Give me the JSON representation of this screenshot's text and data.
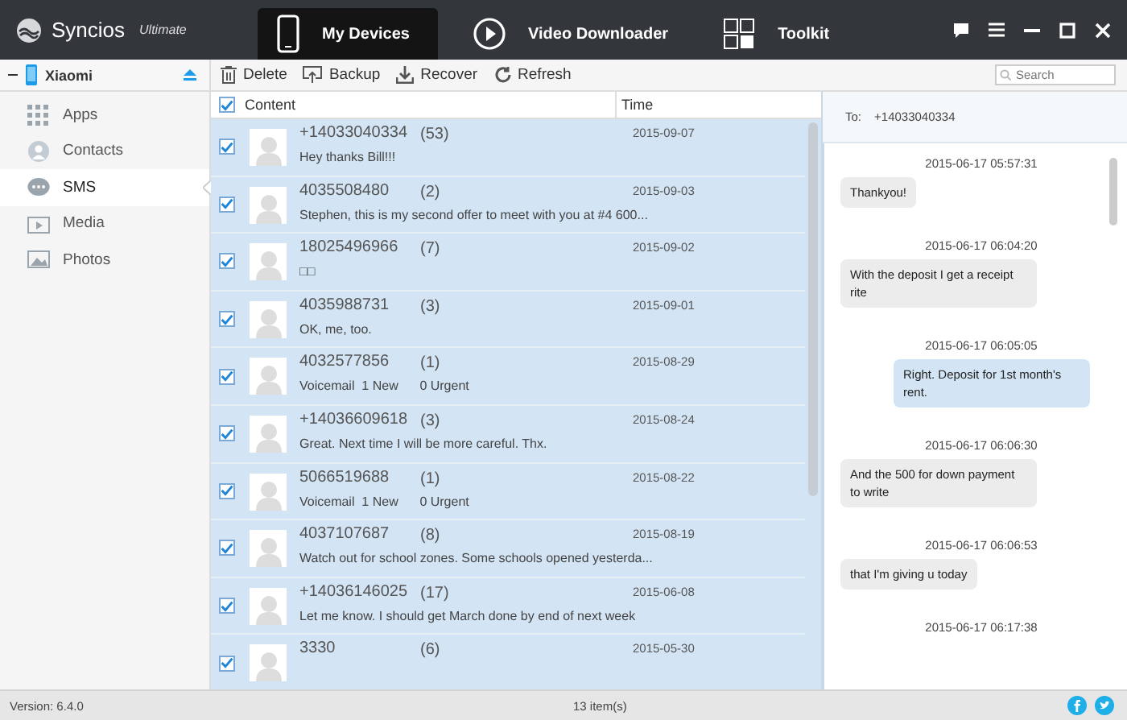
{
  "app": {
    "name": "Syncios",
    "edition": "Ultimate"
  },
  "tabs": [
    {
      "label": "My Devices",
      "selected": true
    },
    {
      "label": "Video Downloader",
      "selected": false
    },
    {
      "label": "Toolkit",
      "selected": false
    }
  ],
  "device": {
    "name": "Xiaomi"
  },
  "sidebar": {
    "items": [
      {
        "label": "Apps",
        "selected": false
      },
      {
        "label": "Contacts",
        "selected": false
      },
      {
        "label": "SMS",
        "selected": true
      },
      {
        "label": "Media",
        "selected": false
      },
      {
        "label": "Photos",
        "selected": false
      }
    ]
  },
  "toolbar": [
    {
      "label": "Delete"
    },
    {
      "label": "Backup"
    },
    {
      "label": "Recover"
    },
    {
      "label": "Refresh"
    }
  ],
  "search": {
    "placeholder": "Search"
  },
  "list": {
    "all_checked": true,
    "columns": [
      "Content",
      "Time"
    ],
    "rows": [
      {
        "number": "+14033040334",
        "count": "(53)",
        "preview": "Hey thanks Bill!!!",
        "time": "2015-09-07",
        "checked": true
      },
      {
        "number": "4035508480",
        "count": "(2)",
        "preview": "Stephen, this is my second offer to meet with you at #4 600...",
        "time": "2015-09-03",
        "checked": true
      },
      {
        "number": "18025496966",
        "count": "(7)",
        "preview": "□□",
        "time": "2015-09-02",
        "checked": true
      },
      {
        "number": "4035988731",
        "count": "(3)",
        "preview": "OK, me, too.",
        "time": "2015-09-01",
        "checked": true
      },
      {
        "number": "4032577856",
        "count": "(1)",
        "preview": "Voicemail  1 New      0 Urgent",
        "time": "2015-08-29",
        "checked": true
      },
      {
        "number": "+14036609618",
        "count": "(3)",
        "preview": "Great. Next time I will be more careful. Thx.",
        "time": "2015-08-24",
        "checked": true
      },
      {
        "number": "5066519688",
        "count": "(1)",
        "preview": "Voicemail  1 New      0 Urgent",
        "time": "2015-08-22",
        "checked": true
      },
      {
        "number": "4037107687",
        "count": "(8)",
        "preview": "Watch out for school zones. Some schools opened yesterda...",
        "time": "2015-08-19",
        "checked": true
      },
      {
        "number": "+14036146025",
        "count": "(17)",
        "preview": "Let me know. I should get March done by end of next week",
        "time": "2015-06-08",
        "checked": true
      },
      {
        "number": "3330",
        "count": "(6)",
        "time": "2015-05-30",
        "checked": true
      }
    ]
  },
  "chat": {
    "to_label": "To:",
    "to": "+14033040334",
    "messages": [
      {
        "time": "2015-06-17 05:57:31",
        "text": "Thankyou!",
        "kind": "received"
      },
      {
        "time": "2015-06-17 06:04:20",
        "text": "With the deposit I get a receipt rite",
        "kind": "received"
      },
      {
        "time": "2015-06-17 06:05:05",
        "text": "Right. Deposit for 1st month's rent.",
        "kind": "sent"
      },
      {
        "time": "2015-06-17 06:06:30",
        "text": "And the 500 for down payment to write",
        "kind": "received"
      },
      {
        "time": "2015-06-17 06:06:53",
        "text": "that I'm giving u today",
        "kind": "received"
      },
      {
        "time": "2015-06-17 06:17:38"
      }
    ]
  },
  "status_bar": {
    "version": "Version: 6.4.0",
    "count": "13 item(s)"
  }
}
